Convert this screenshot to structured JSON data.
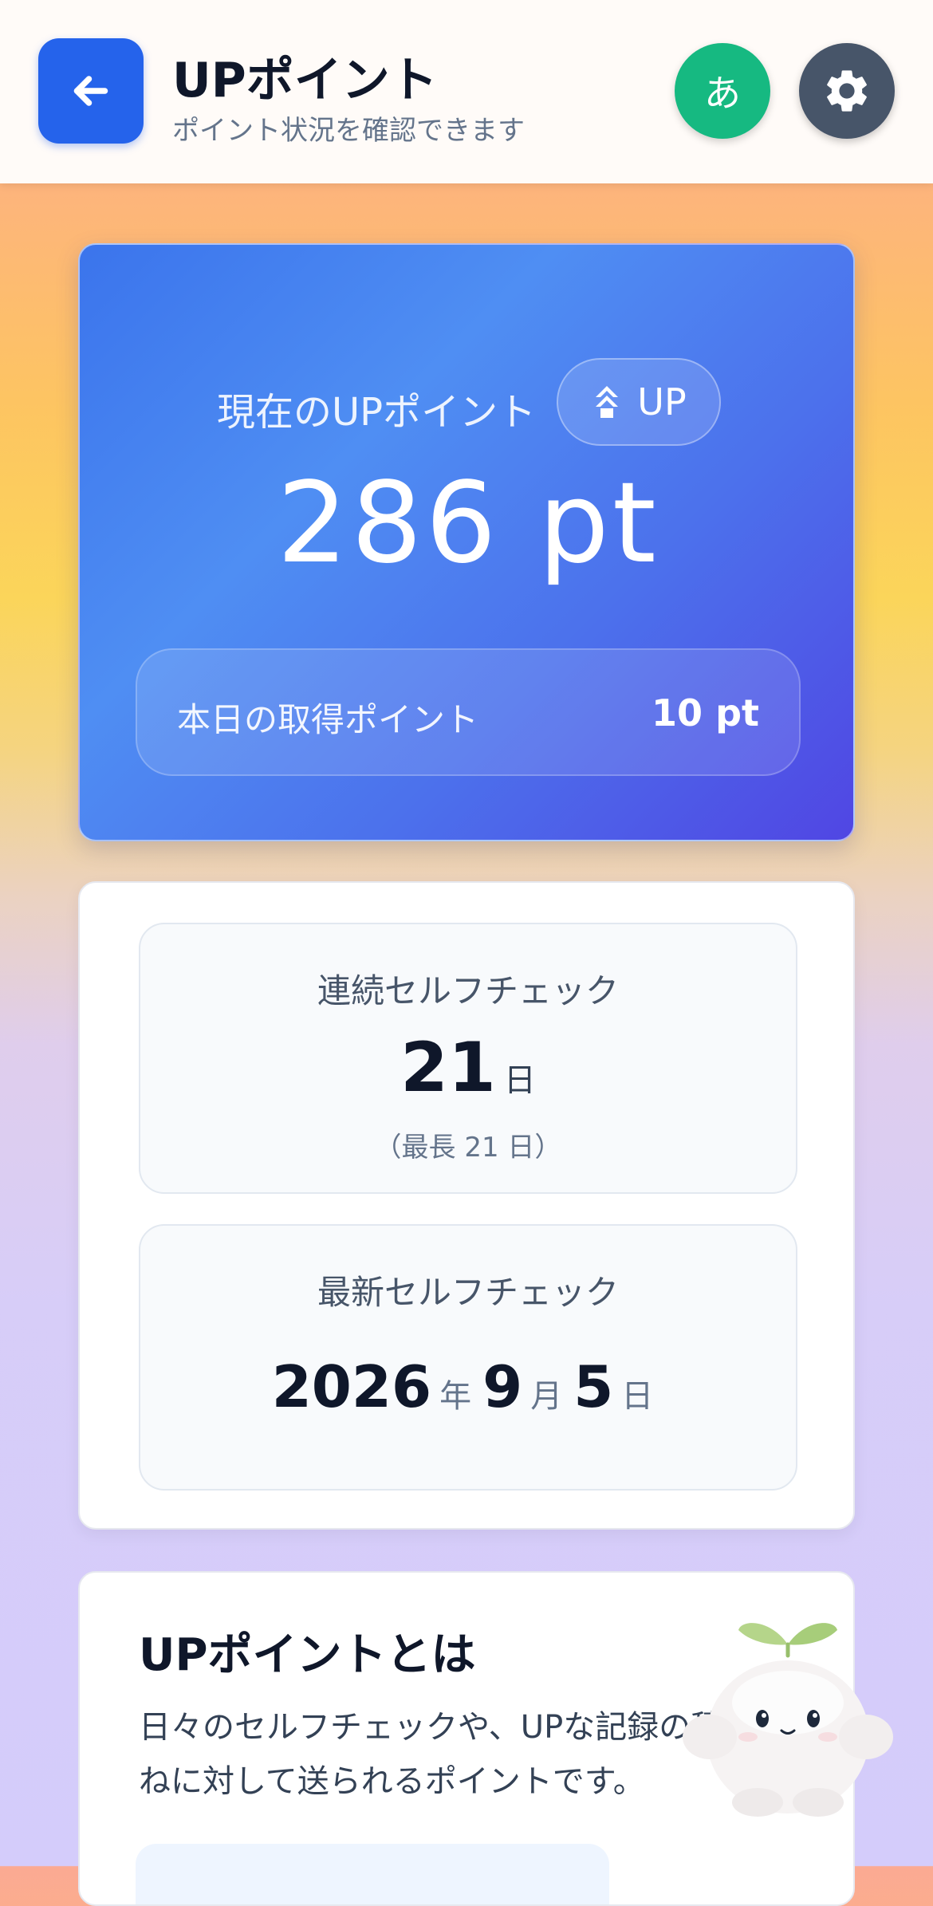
{
  "header": {
    "title": "UPポイント",
    "subtitle": "ポイント状況を確認できます",
    "lang_label": "あ",
    "back_icon": "arrow-left-icon",
    "settings_icon": "gear-icon"
  },
  "points_card": {
    "label": "現在のUPポイント",
    "badge_label": "UP",
    "badge_icon": "chevrons-up-icon",
    "total": "286 pt",
    "today_label": "本日の取得ポイント",
    "today_value": "10 pt"
  },
  "streak": {
    "title": "連続セルフチェック",
    "days": "21",
    "unit": "日",
    "best": "（最長 21 日）"
  },
  "latest": {
    "title": "最新セルフチェック",
    "year": "2026",
    "year_unit": "年",
    "month": "9",
    "month_unit": "月",
    "day": "5",
    "day_unit": "日"
  },
  "about": {
    "title": "UPポイントとは",
    "text": "日々のセルフチェックや、UPな記録の積み重ねに対して送られるポイントです。"
  },
  "colors": {
    "primary": "#2563eb",
    "lang": "#16b981",
    "settings": "#475569"
  }
}
